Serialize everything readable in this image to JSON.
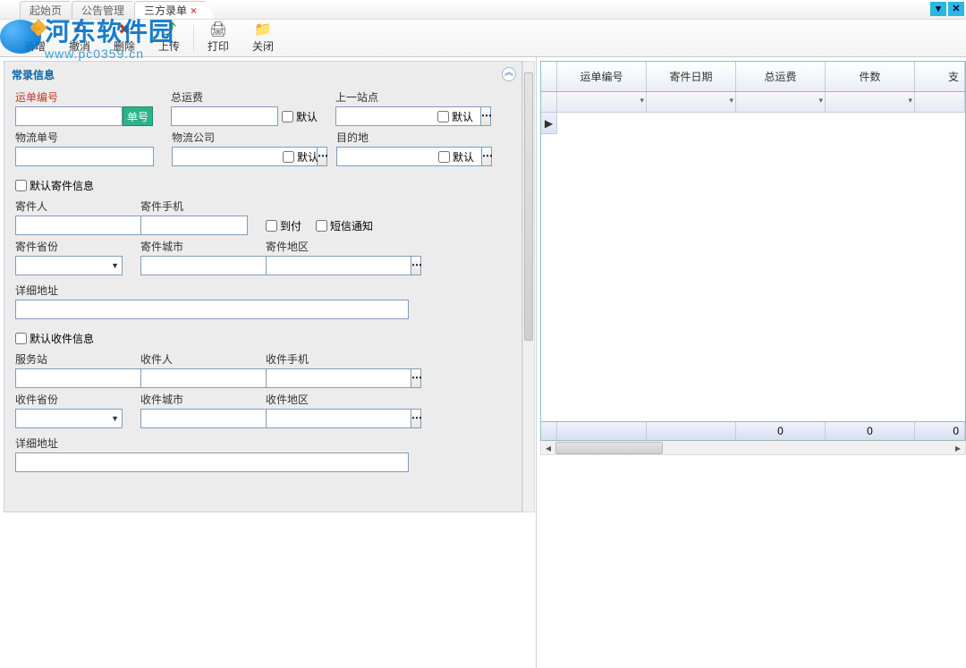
{
  "tabs": {
    "start": "起始页",
    "notice": "公告管理",
    "third": "三方录单",
    "close": "×"
  },
  "window": {
    "min": "▾",
    "close": "✕"
  },
  "toolbar": {
    "new": "新增",
    "undo": "撤消",
    "delete": "删除",
    "upload": "上传",
    "print": "打印",
    "close": "关闭",
    "icons": {
      "new": "✚",
      "undo": "↶",
      "delete": "✖",
      "upload": "⤴",
      "print": "🖨",
      "close": "📁"
    }
  },
  "watermark": {
    "title": "河东软件园",
    "sub": "www.pc0359.cn"
  },
  "panel": {
    "title": "常录信息",
    "caret": "︽"
  },
  "labels": {
    "waybill_no": "运单编号",
    "gen_btn": "单号",
    "total_fee": "总运费",
    "default": "默认",
    "prev_site": "上一站点",
    "logistics_no": "物流单号",
    "logistics_co": "物流公司",
    "destination": "目的地",
    "default_sender": "默认寄件信息",
    "sender": "寄件人",
    "sender_phone": "寄件手机",
    "cod": "到付",
    "sms": "短信通知",
    "sender_prov": "寄件省份",
    "sender_city": "寄件城市",
    "sender_area": "寄件地区",
    "detail_addr": "详细地址",
    "default_receiver": "默认收件信息",
    "service_station": "服务站",
    "receiver": "收件人",
    "receiver_phone": "收件手机",
    "receiver_prov": "收件省份",
    "receiver_city": "收件城市",
    "receiver_area": "收件地区"
  },
  "grid": {
    "cols": [
      "运单编号",
      "寄件日期",
      "总运费",
      "件数"
    ],
    "last_partial": "支",
    "footer_vals": [
      "",
      "",
      "0",
      "0",
      "0"
    ],
    "row_indicator": "▶"
  },
  "chart_data": {
    "type": "table",
    "columns": [
      "运单编号",
      "寄件日期",
      "总运费",
      "件数"
    ],
    "rows": [],
    "summary": {
      "总运费": 0,
      "件数": 0,
      "extra": 0
    }
  }
}
